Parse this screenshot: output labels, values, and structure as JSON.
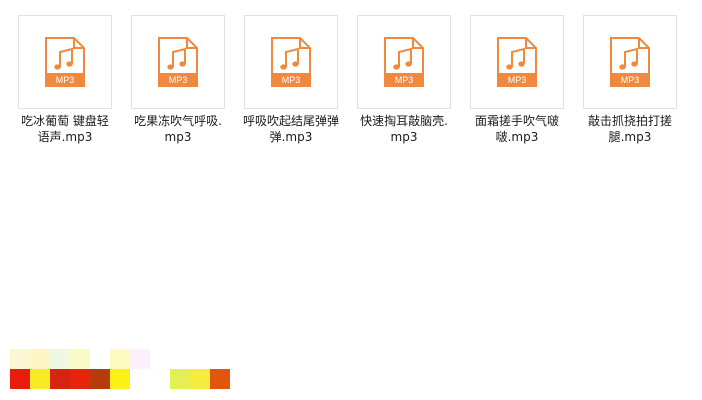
{
  "icon": {
    "name": "mp3-file-icon",
    "label": "MP3",
    "color": "#f0883e"
  },
  "files": [
    {
      "name": "吃冰葡萄 键盘轻语声.mp3"
    },
    {
      "name": "吃果冻吹气呼吸.mp3"
    },
    {
      "name": "呼吸吹起结尾弹弹弹.mp3"
    },
    {
      "name": "快速掏耳敲脑壳.mp3"
    },
    {
      "name": "面霜搓手吹气啵啵.mp3"
    },
    {
      "name": "敲击抓挠拍打搓腿.mp3"
    }
  ],
  "watermark": {
    "colors": [
      "#fbf7d3",
      "#fdf5c4",
      "#edf7e2",
      "#fafac9",
      "#ffffff",
      "#fdfbbf",
      "#fcf0fa",
      "#ffffff",
      "#ffffff",
      "#ffffff",
      "#ffffff",
      "#e81c0c",
      "#f7ec24",
      "#d62410",
      "#e6260c",
      "#b63a0a",
      "#faf214",
      "#ffffff",
      "#ffffff",
      "#e2f056",
      "#f5ec40",
      "#e0560c"
    ]
  }
}
